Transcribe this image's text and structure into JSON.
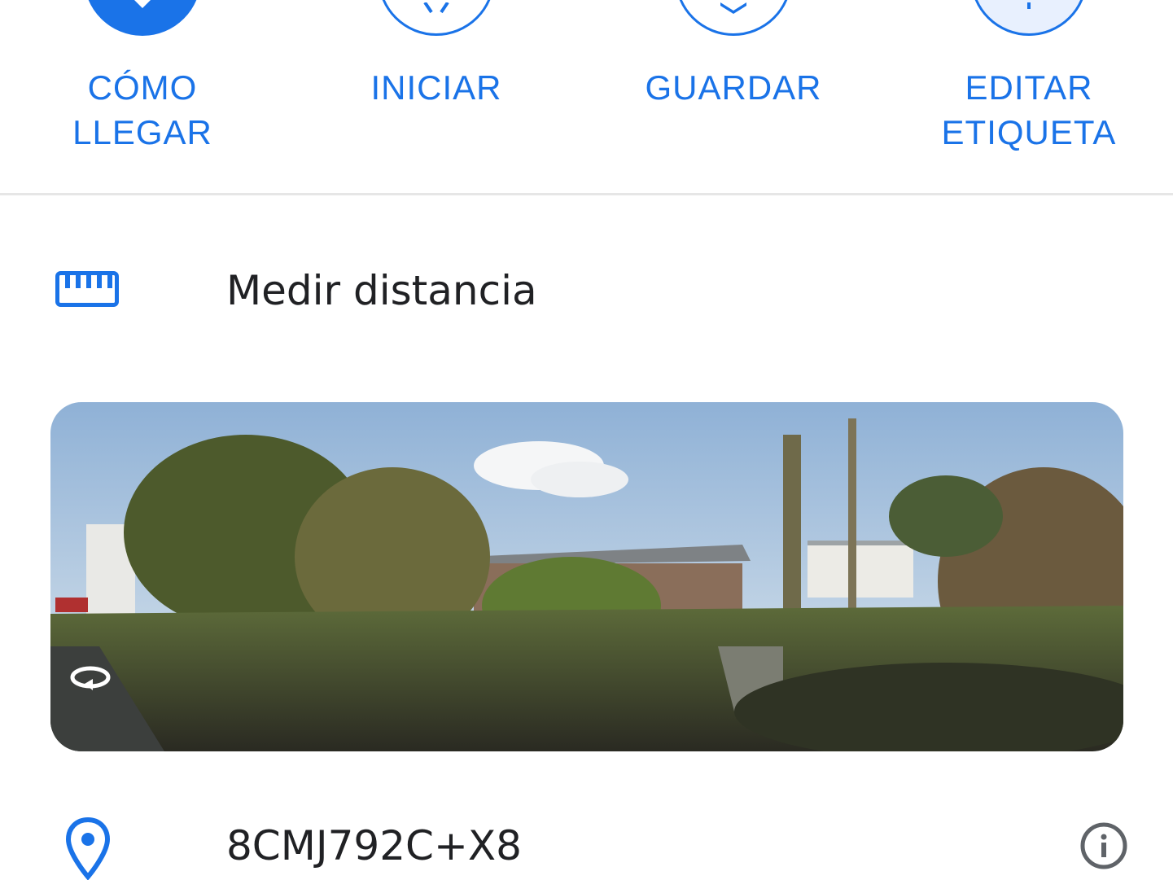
{
  "actions": [
    {
      "label": "CÓMO\nLLEGAR",
      "icon": "directions-icon"
    },
    {
      "label": "INICIAR",
      "icon": "navigation-start-icon"
    },
    {
      "label": "GUARDAR",
      "icon": "bookmark-icon"
    },
    {
      "label": "EDITAR\nETIQUETA",
      "icon": "label-icon"
    }
  ],
  "measure": {
    "label": "Medir distancia",
    "icon": "ruler-icon"
  },
  "street_view": {
    "icon": "rotate-360-icon"
  },
  "plus_code": {
    "label": "8CMJ792C+X8",
    "icon": "location-pin-icon",
    "info_icon": "info-icon"
  },
  "colors": {
    "accent": "#1a73e8",
    "text": "#202124",
    "icon_gray": "#5f6368",
    "divider": "#e6e6e6"
  }
}
